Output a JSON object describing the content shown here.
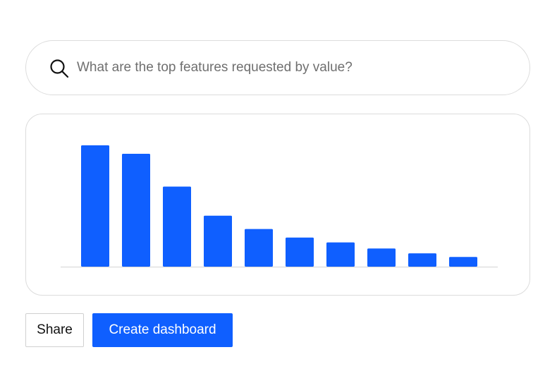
{
  "search": {
    "placeholder": "What are the top features requested by value?",
    "value": "",
    "icon": "search-icon"
  },
  "chart_data": {
    "type": "bar",
    "title": "",
    "xlabel": "",
    "ylabel": "",
    "categories": [
      "",
      "",
      "",
      "",
      "",
      "",
      "",
      "",
      "",
      ""
    ],
    "values": [
      100,
      93,
      66,
      42,
      31,
      24,
      20,
      15,
      11,
      8
    ],
    "ylim": [
      0,
      100
    ],
    "grid": false,
    "bar_color": "#0f5fff",
    "baseline_color": "#d4d4d4"
  },
  "actions": {
    "share_label": "Share",
    "create_label": "Create dashboard"
  },
  "colors": {
    "accent": "#0f5fff",
    "accent_text": "#ffffff"
  }
}
